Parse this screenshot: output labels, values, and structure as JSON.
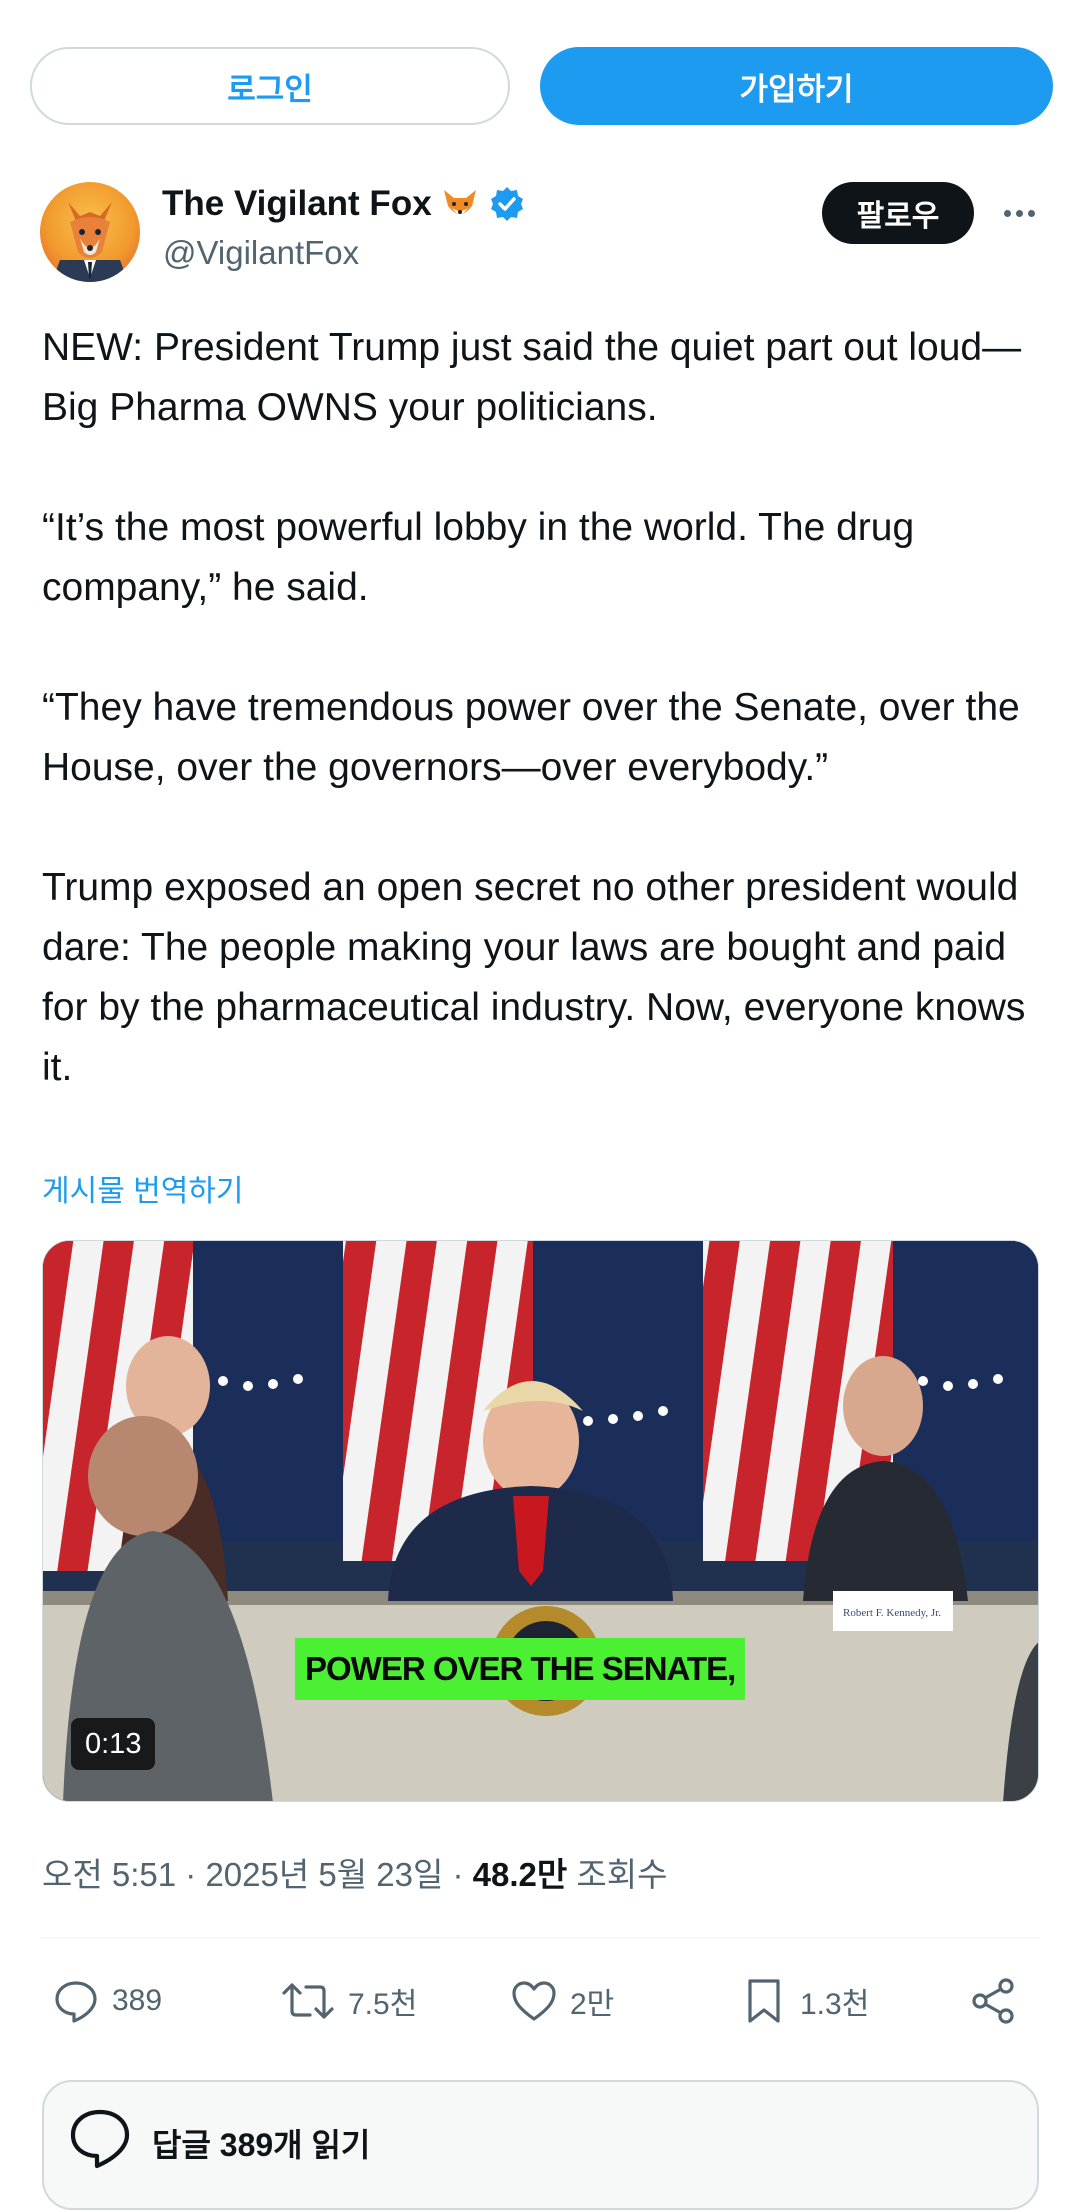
{
  "topbar": {
    "login_label": "로그인",
    "signup_label": "가입하기"
  },
  "author": {
    "display_name": "The Vigilant Fox",
    "handle": "@VigilantFox",
    "follow_label": "팔로우"
  },
  "tweet": {
    "paragraphs": [
      "NEW: President Trump just said the quiet part out loud—Big Pharma OWNS your politicians.",
      "“It’s the most powerful lobby in the world. The drug company,” he said.",
      "“They have tremendous power over the Senate, over the House, over the governors—over everybody.”",
      "Trump exposed an open secret no other president would dare: The people making your laws are bought and paid for by the pharmaceutical industry. Now, everyone knows it."
    ],
    "translate_label": "게시물 번역하기"
  },
  "video": {
    "caption": "POWER OVER THE SENATE,",
    "duration": "0:13",
    "nameplate": "Robert F. Kennedy, Jr."
  },
  "meta": {
    "time_date": "오전 5:51 · 2025년 5월 23일 · ",
    "views_count": "48.2만",
    "views_label": " 조회수"
  },
  "actions": {
    "reply_count": "389",
    "retweet_count": "7.5천",
    "like_count": "2만",
    "bookmark_count": "1.3천"
  },
  "replies": {
    "label": "답글 389개 읽기"
  },
  "colors": {
    "accent": "#1d9bf0",
    "text": "#0f1419",
    "muted": "#536471",
    "caption_bg": "#4cf033"
  }
}
